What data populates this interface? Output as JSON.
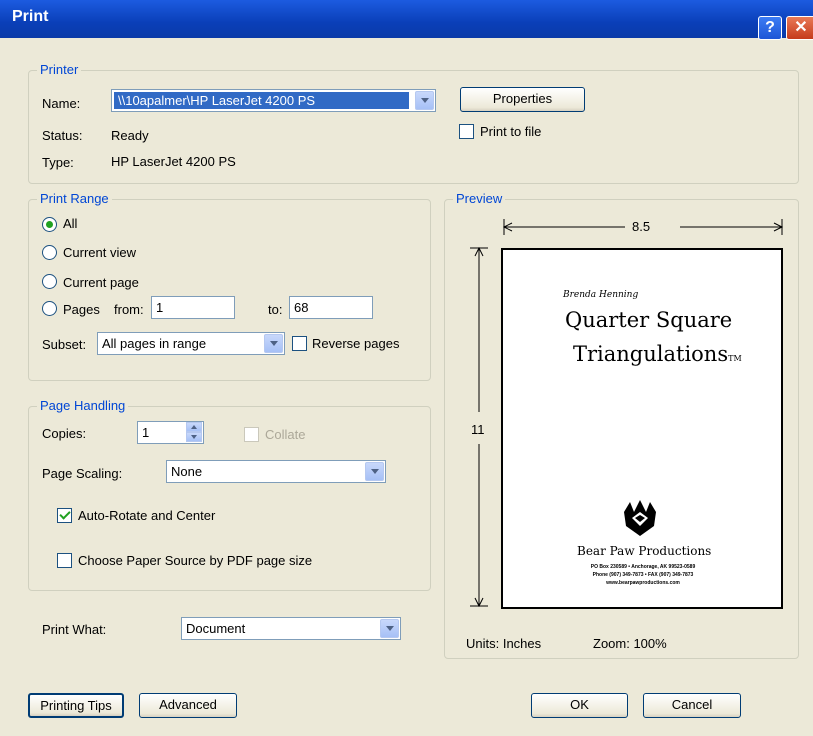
{
  "window": {
    "title": "Print",
    "help_glyph": "?",
    "close_glyph": "✕"
  },
  "printer": {
    "legend": "Printer",
    "name_label": "Name:",
    "name_value": "\\\\10apalmer\\HP LaserJet 4200 PS",
    "status_label": "Status:",
    "status_value": "Ready",
    "type_label": "Type:",
    "type_value": "HP LaserJet 4200 PS",
    "properties_label": "Properties",
    "print_to_file_label": "Print to file",
    "print_to_file_checked": false
  },
  "print_range": {
    "legend": "Print Range",
    "all_label": "All",
    "current_view_label": "Current view",
    "current_page_label": "Current page",
    "pages_label": "Pages",
    "from_label": "from:",
    "from_value": "1",
    "to_label": "to:",
    "to_value": "68",
    "selected": "All",
    "subset_label": "Subset:",
    "subset_value": "All pages in range",
    "reverse_label": "Reverse pages",
    "reverse_checked": false
  },
  "page_handling": {
    "legend": "Page Handling",
    "copies_label": "Copies:",
    "copies_value": "1",
    "collate_label": "Collate",
    "collate_enabled": false,
    "scaling_label": "Page Scaling:",
    "scaling_value": "None",
    "auto_rotate_label": "Auto-Rotate and Center",
    "auto_rotate_checked": true,
    "paper_source_label": "Choose Paper Source by PDF page size",
    "paper_source_checked": false
  },
  "print_what": {
    "label": "Print What:",
    "value": "Document"
  },
  "preview": {
    "legend": "Preview",
    "width_label": "8.5",
    "height_label": "11",
    "units_text": "Units: Inches",
    "zoom_text": "Zoom: 100%",
    "page": {
      "author": "Brenda Henning",
      "title_line1": "Quarter Square",
      "title_line2": "Triangulations",
      "title_mark": "TM",
      "publisher": "Bear Paw Productions",
      "address_line1": "PO Box 230589 • Anchorage, AK 99523-0589",
      "address_line2": "Phone (907) 349-7873 • FAX (907) 349-7873",
      "address_line3": "www.bearpawproductions.com"
    }
  },
  "buttons": {
    "printing_tips": "Printing Tips",
    "advanced": "Advanced",
    "ok": "OK",
    "cancel": "Cancel"
  },
  "colors": {
    "dialog_bg": "#ece9d8",
    "titlebar": "#0a3fb8",
    "group_legend": "#0046d5",
    "selection": "#316ac5",
    "check_green": "#21a121"
  }
}
